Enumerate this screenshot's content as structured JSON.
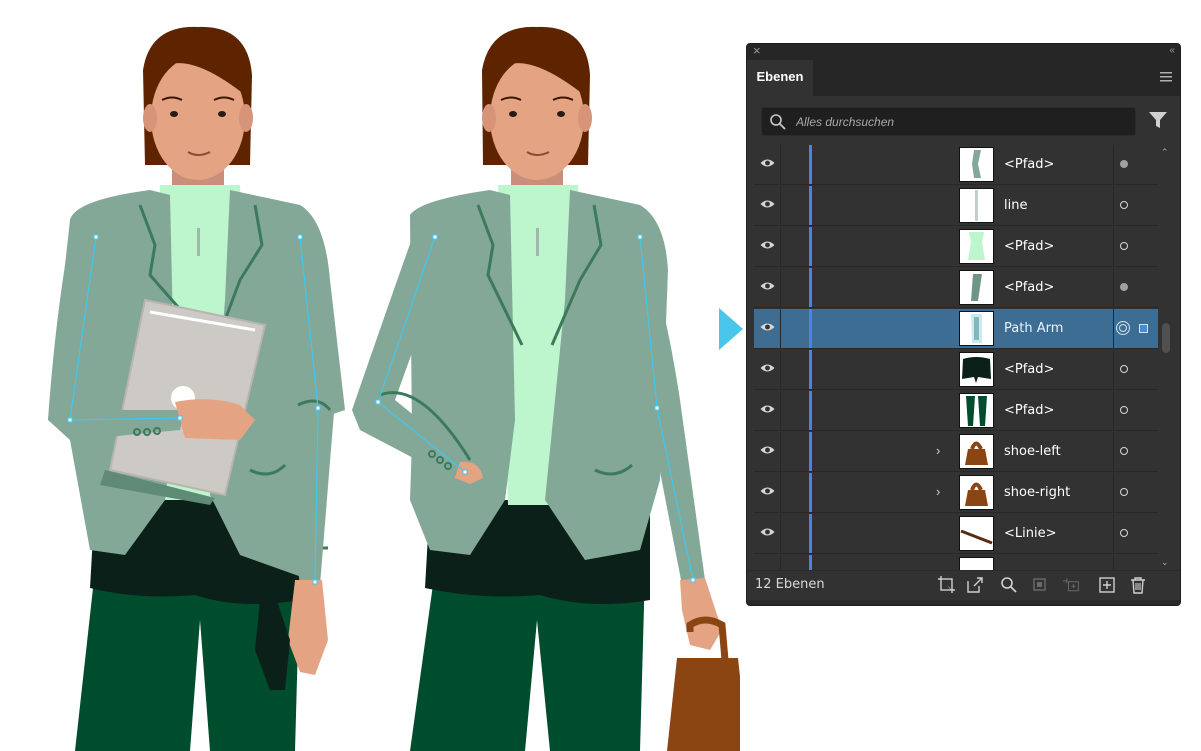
{
  "panel": {
    "tab_label": "Ebenen",
    "close_glyph": "×",
    "collapse_glyph": "‹‹",
    "search": {
      "placeholder": "Alles durchsuchen",
      "value": ""
    },
    "layers": [
      {
        "name": "<Pfad>",
        "thumb": "arm-gray",
        "target": "filled",
        "expandable": false,
        "selected": false
      },
      {
        "name": "line",
        "thumb": "line",
        "target": "empty",
        "expandable": false,
        "selected": false
      },
      {
        "name": "<Pfad>",
        "thumb": "shirt",
        "target": "empty",
        "expandable": false,
        "selected": false
      },
      {
        "name": "<Pfad>",
        "thumb": "arm-green",
        "target": "filled",
        "expandable": false,
        "selected": false
      },
      {
        "name": "Path Arm",
        "thumb": "arm-light",
        "target": "active",
        "expandable": false,
        "selected": true
      },
      {
        "name": "<Pfad>",
        "thumb": "shorts-dark",
        "target": "empty",
        "expandable": false,
        "selected": false
      },
      {
        "name": "<Pfad>",
        "thumb": "pants-green",
        "target": "empty",
        "expandable": false,
        "selected": false
      },
      {
        "name": "shoe-left",
        "thumb": "bag-brown",
        "target": "empty",
        "expandable": true,
        "selected": false
      },
      {
        "name": "shoe-right",
        "thumb": "bag-brown",
        "target": "empty",
        "expandable": true,
        "selected": false
      },
      {
        "name": "<Linie>",
        "thumb": "diag-line",
        "target": "empty",
        "expandable": false,
        "selected": false
      }
    ],
    "footer": {
      "count_label": "12 Ebenen"
    },
    "icons": [
      "eye-icon",
      "search-icon",
      "filter-icon",
      "panel-menu-icon",
      "collect-for-export-icon",
      "export-icon",
      "locate-object-icon",
      "clipping-mask-icon",
      "new-sublayer-icon",
      "new-layer-icon",
      "trash-icon"
    ]
  },
  "colors": {
    "panel_bg": "#323232",
    "selected_row": "#3e6d93",
    "layer_color_bar": "#4f7fe8",
    "jacket": "#84a898",
    "shirt": "#bdf5cc",
    "pants": "#004d2e",
    "hair": "#5e2400",
    "skin": "#e4a483",
    "bag": "#8b4513"
  }
}
